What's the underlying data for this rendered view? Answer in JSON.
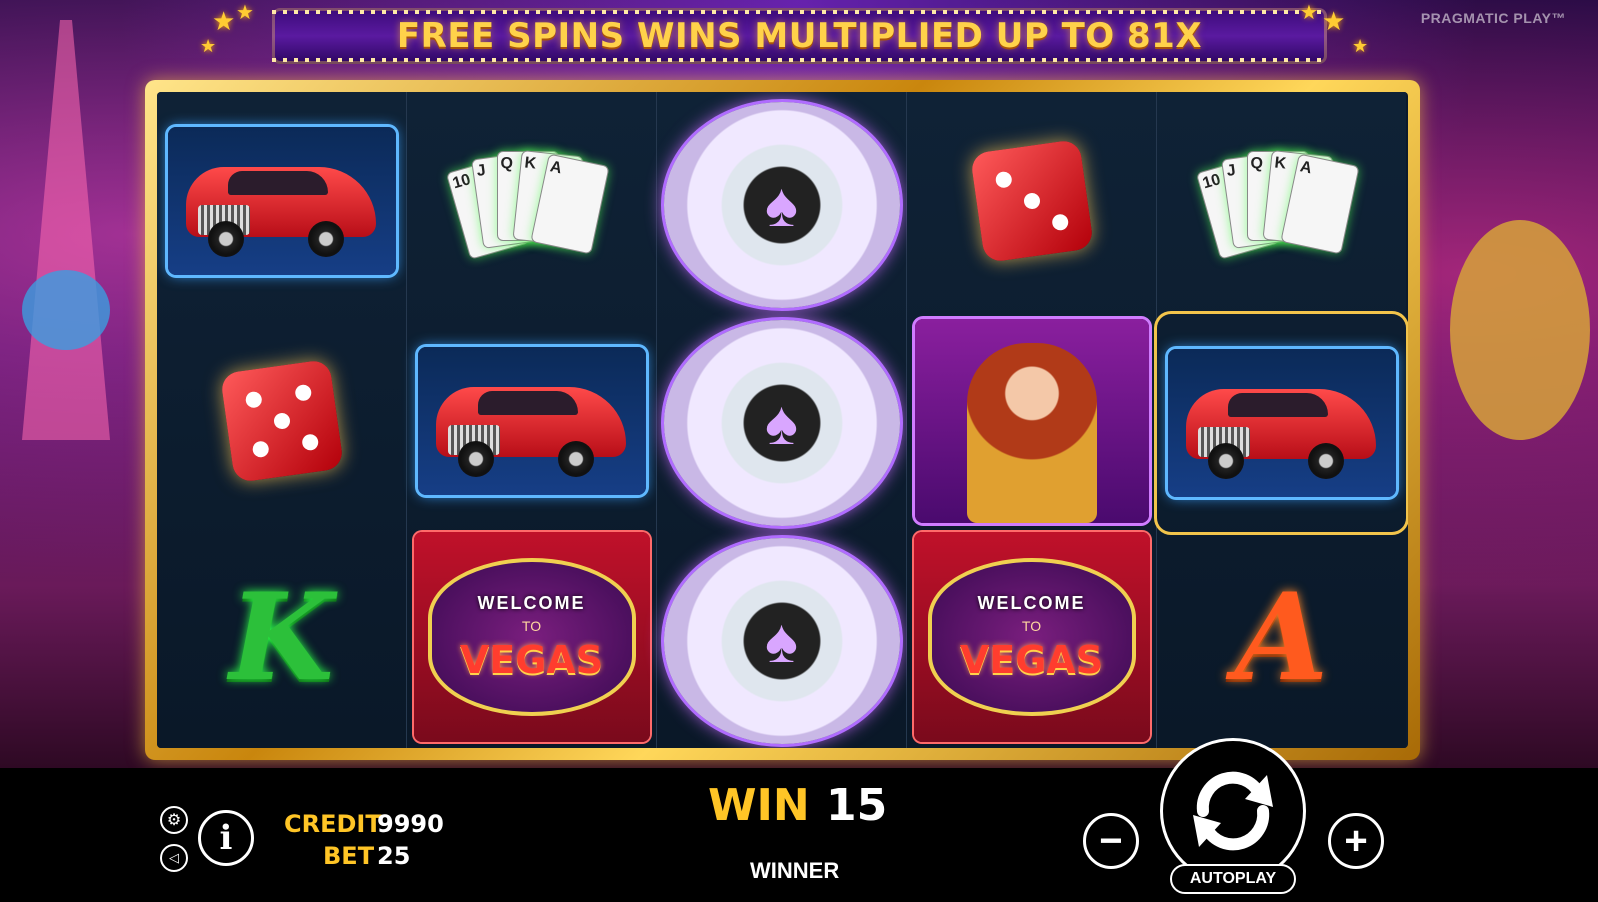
{
  "banner": {
    "text": "FREE SPINS WINS MULTIPLIED UP TO 81X"
  },
  "brand": "PRAGMATIC PLAY™",
  "reels": [
    [
      "car",
      "dice",
      "letter-k"
    ],
    [
      "cards",
      "car",
      "welcome-vegas"
    ],
    [
      "chip",
      "chip",
      "chip"
    ],
    [
      "dice",
      "lady",
      "welcome-vegas"
    ],
    [
      "cards",
      "car",
      "letter-a"
    ]
  ],
  "symbols": {
    "letter_k": "K",
    "letter_a": "A",
    "welcome": "WELCOME",
    "to": "TO",
    "vegas": "VEGAS",
    "cards_1": [
      "10",
      "J",
      "Q",
      "K",
      "A"
    ]
  },
  "bottom": {
    "credit_label": "CREDIT",
    "credit_value": "9990",
    "bet_label": "BET",
    "bet_value": "25",
    "win_label": "WIN",
    "win_value": "15",
    "status": "WINNER",
    "autoplay_label": "AUTOPLAY"
  },
  "colors": {
    "gold": "#ffc526",
    "banner_text": "#ffd24a",
    "frame_gold": "#c9860d",
    "reel_bg": "#0c1a2c"
  },
  "icons": {
    "settings": "gear-icon",
    "info": "info-icon",
    "sound": "speaker-icon",
    "minus": "minus-icon",
    "plus": "plus-icon",
    "spin": "spin-arrows-icon"
  }
}
